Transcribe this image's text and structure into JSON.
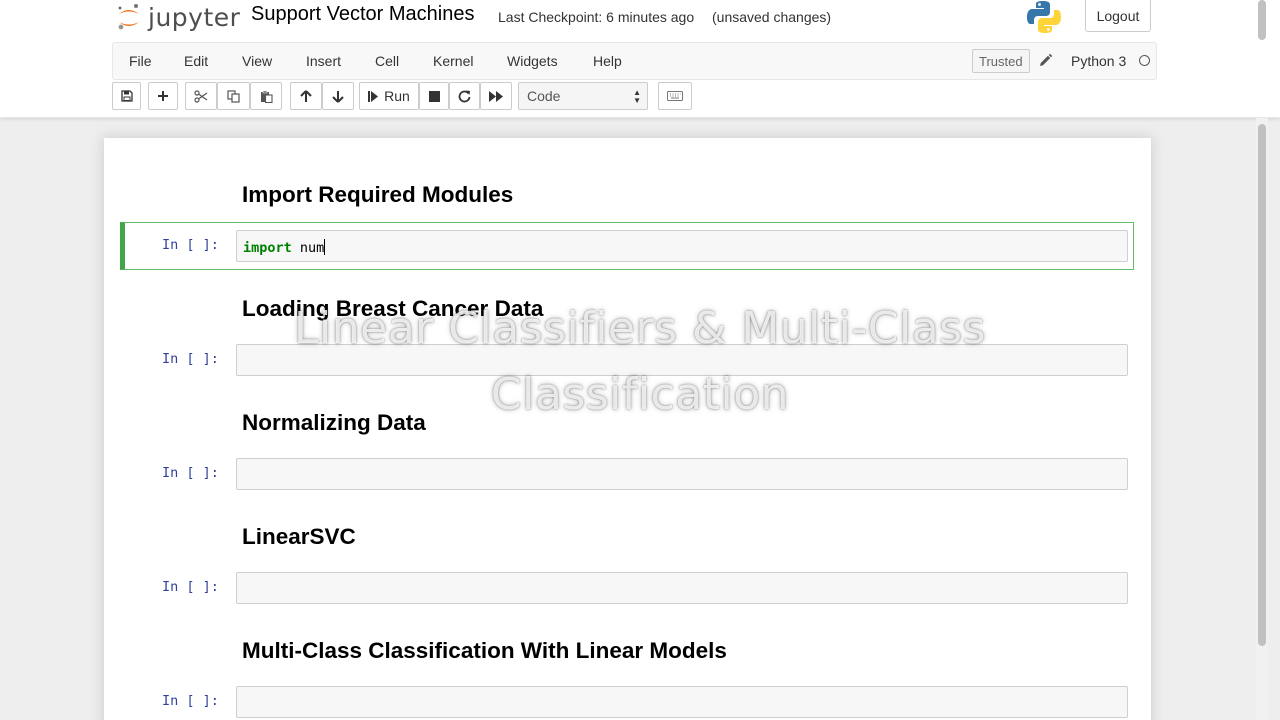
{
  "header": {
    "logo_text": "jupyter",
    "notebook_title": "Support Vector Machines",
    "checkpoint": "Last Checkpoint: 6 minutes ago",
    "save_status": "(unsaved changes)",
    "logout_label": "Logout"
  },
  "menubar": {
    "items": [
      "File",
      "Edit",
      "View",
      "Insert",
      "Cell",
      "Kernel",
      "Widgets",
      "Help"
    ],
    "trusted_label": "Trusted",
    "kernel_name": "Python 3"
  },
  "toolbar": {
    "run_label": "Run",
    "cell_type": "Code",
    "icons": [
      "save-icon",
      "plus-icon",
      "cut-icon",
      "copy-icon",
      "paste-icon",
      "arrow-up-icon",
      "arrow-down-icon",
      "step-forward-icon",
      "stop-icon",
      "restart-icon",
      "fast-forward-icon",
      "keyboard-icon"
    ]
  },
  "notebook": {
    "headings": [
      "Import Required Modules",
      "Loading Breast Cancer Data",
      "Normalizing Data",
      "LinearSVC",
      "Multi-Class Classification With Linear Models"
    ],
    "prompts": [
      "In [ ]:",
      "In [ ]:",
      "In [ ]:",
      "In [ ]:",
      "In [ ]:"
    ],
    "first_cell_keyword": "import",
    "first_cell_rest": " num"
  },
  "overlay": {
    "line1": "Linear Classifiers & Multi-Class",
    "line2": "Classification"
  },
  "colors": {
    "selected_cell_border": "#42a548",
    "prompt_color": "#303f9f",
    "keyword_color": "#008000"
  }
}
